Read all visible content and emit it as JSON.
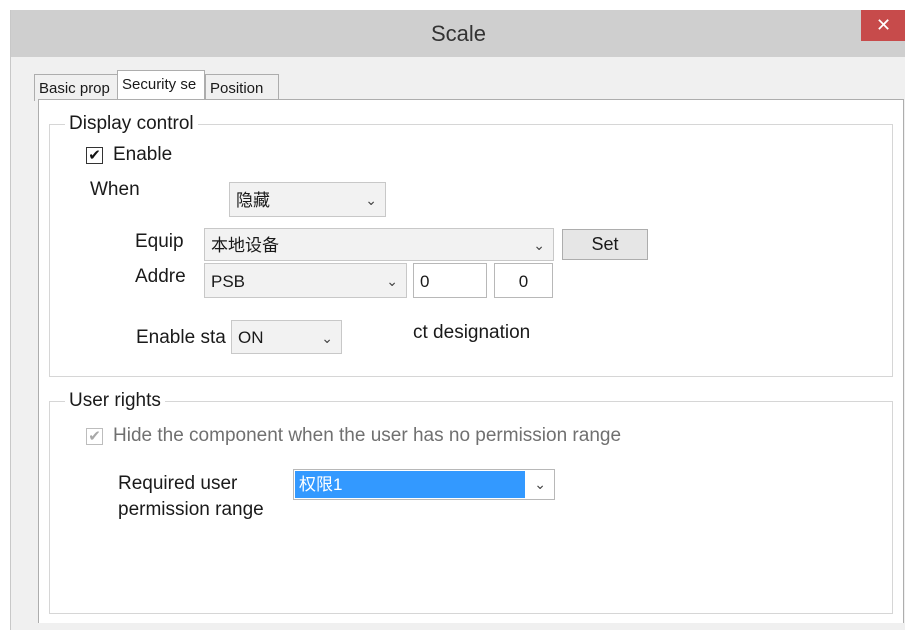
{
  "window": {
    "title": "Scale",
    "close_glyph": "✕"
  },
  "tabs": [
    {
      "label": "Basic prop"
    },
    {
      "label": "Security se"
    },
    {
      "label": "Position"
    }
  ],
  "display_control": {
    "legend": "Display control",
    "enable_label": "Enable",
    "enable_checked": true,
    "when_label": "When",
    "when_value": "隐藏",
    "equip_label": "Equip",
    "equip_value": "本地设备",
    "set_label": "Set",
    "addr_label": "Addre",
    "addr_type": "PSB",
    "addr_value1": "0",
    "addr_value2": "0",
    "enable_state_label": "Enable sta",
    "enable_state_value": "ON",
    "designation_text": "ct designation"
  },
  "user_rights": {
    "legend": "User rights",
    "hide_label": "Hide the component when the user has no permission range",
    "hide_checked": true,
    "required_label_line1": "Required user",
    "required_label_line2": "permission range",
    "permission_value": "权限1"
  },
  "glyphs": {
    "chevron": "⌄",
    "check": "✔"
  }
}
